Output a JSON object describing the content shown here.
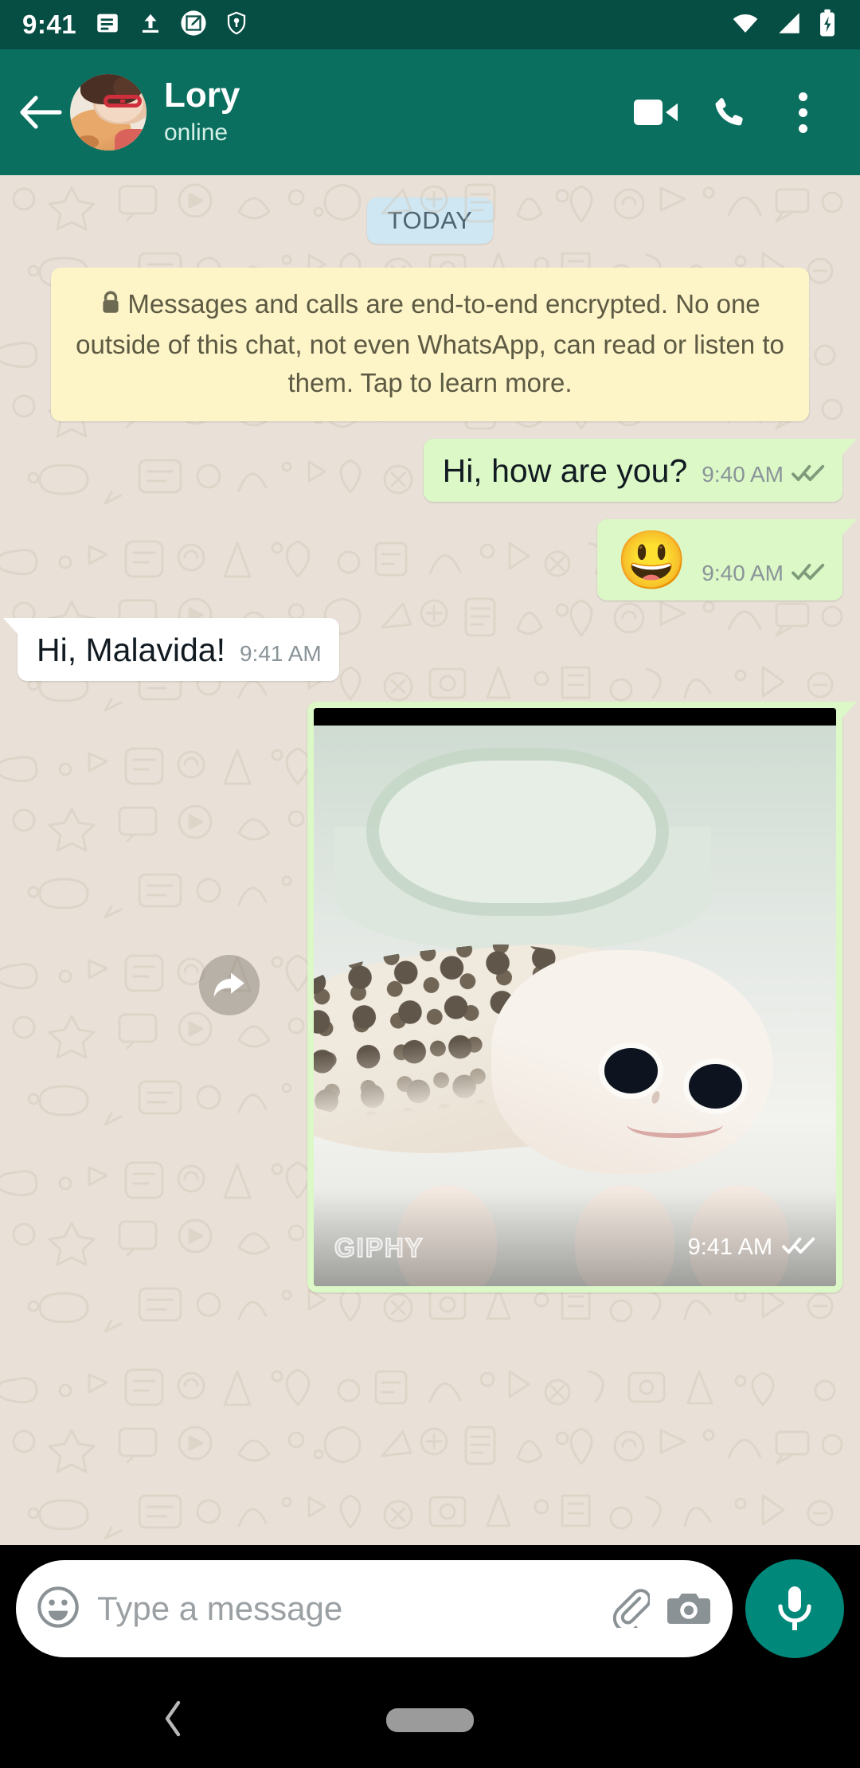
{
  "status_bar": {
    "time": "9:41",
    "left_icons": [
      "notes-notification-icon",
      "upload-arrow-icon",
      "screenshot-edit-icon",
      "vpn-key-shield-icon"
    ],
    "right_icons": [
      "wifi-icon",
      "cellular-signal-icon",
      "battery-charging-icon"
    ],
    "background_color": "#064d43"
  },
  "app_bar": {
    "back_label": "Back",
    "contact_name": "Lory",
    "presence": "online",
    "actions": [
      "video-call",
      "voice-call",
      "more-options"
    ],
    "background_color": "#0a6f5f"
  },
  "chat": {
    "background_color": "#e9e1d8",
    "day_divider": "TODAY",
    "encryption_notice": "Messages and calls are end-to-end encrypted. No one outside of this chat, not even WhatsApp, can read or listen to them. Tap to learn more.",
    "messages": [
      {
        "id": "msg-1",
        "direction": "outgoing",
        "type": "text",
        "text": "Hi, how are you?",
        "time": "9:40 AM",
        "status": "read"
      },
      {
        "id": "msg-2",
        "direction": "outgoing",
        "type": "emoji",
        "text": "😃",
        "time": "9:40 AM",
        "status": "read"
      },
      {
        "id": "msg-3",
        "direction": "incoming",
        "type": "text",
        "text": "Hi, Malavida!",
        "time": "9:41 AM",
        "status": ""
      },
      {
        "id": "msg-4",
        "direction": "outgoing",
        "type": "gif",
        "attribution": "GIPHY",
        "time": "9:41 AM",
        "status": "read",
        "forward_label": "Forward"
      }
    ],
    "bubble_colors": {
      "outgoing": "#dcf8c6",
      "incoming": "#ffffff",
      "day_chip": "#cfe7f3",
      "encryption": "#fdf4c8"
    }
  },
  "composer": {
    "placeholder": "Type a message",
    "value": "",
    "emoji_button": "emoji-icon",
    "attach_button": "paperclip-icon",
    "camera_button": "camera-icon",
    "mic_button": "microphone-icon",
    "mic_color": "#00887a"
  },
  "nav_bar": {
    "back": "back-chevron",
    "home": "home-pill",
    "background_color": "#000000"
  }
}
